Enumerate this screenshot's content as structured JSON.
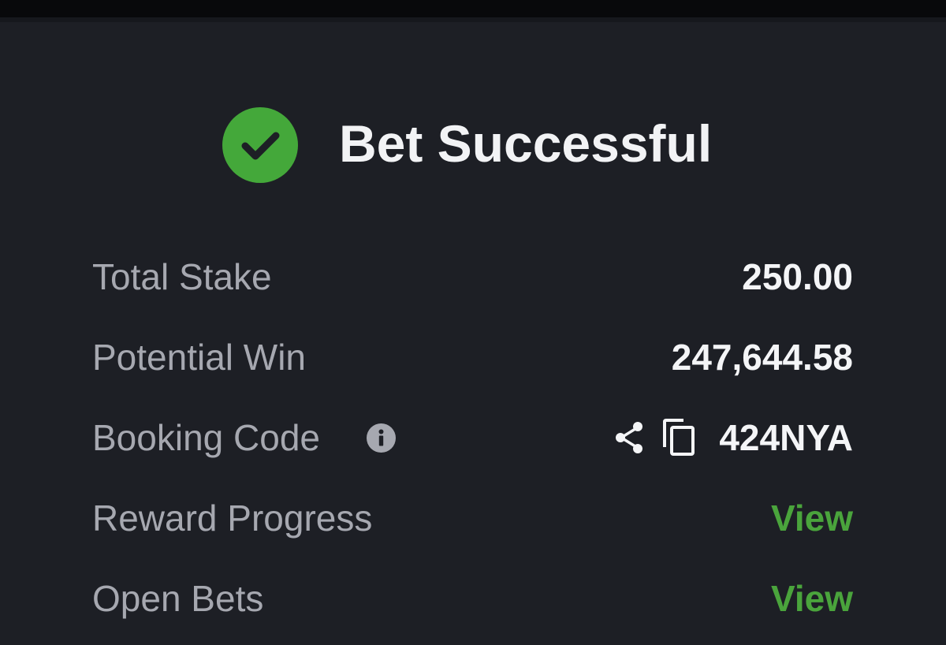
{
  "header": {
    "title": "Bet Successful",
    "status_icon": "check-circle-icon",
    "status_color": "#44a83a"
  },
  "details": {
    "total_stake": {
      "label": "Total Stake",
      "value": "250.00"
    },
    "potential_win": {
      "label": "Potential Win",
      "value": "247,644.58"
    },
    "booking_code": {
      "label": "Booking Code",
      "value": "424NYA",
      "info_icon": "info-icon",
      "share_icon": "share-icon",
      "copy_icon": "copy-icon"
    },
    "reward_progress": {
      "label": "Reward Progress",
      "link": "View"
    },
    "open_bets": {
      "label": "Open Bets",
      "link": "View"
    }
  },
  "colors": {
    "background": "#1d1f25",
    "label_text": "#a6a8b0",
    "value_text": "#f4f5f7",
    "accent_green": "#4aa43c"
  }
}
